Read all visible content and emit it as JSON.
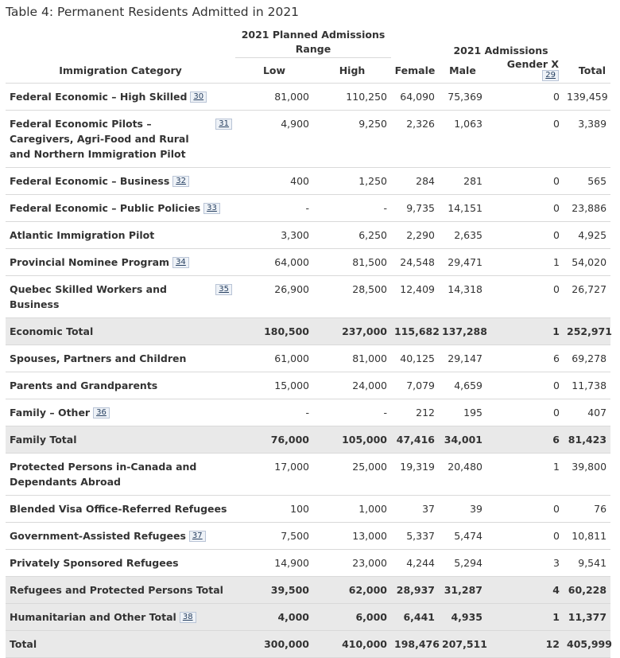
{
  "caption": "Table 4: Permanent Residents Admitted in 2021",
  "headers": {
    "planned_group": "2021 Planned Admissions Range",
    "planned_line1": "2021 Planned Admissions",
    "planned_line2": "Range",
    "admissions_group": "2021 Admissions",
    "category": "Immigration Category",
    "low": "Low",
    "high": "High",
    "female": "Female",
    "male": "Male",
    "gender_x": "Gender X",
    "gender_x_fn": "29",
    "total": "Total"
  },
  "rows": [
    {
      "category": "Federal Economic – High Skilled",
      "fn": "30",
      "low": "81,000",
      "high": "110,250",
      "female": "64,090",
      "male": "75,369",
      "gender_x": "0",
      "total": "139,459",
      "is_total": false
    },
    {
      "category": "Federal Economic Pilots – Caregivers, Agri-Food and Rural and Northern Immigration Pilot",
      "fn": "31",
      "low": "4,900",
      "high": "9,250",
      "female": "2,326",
      "male": "1,063",
      "gender_x": "0",
      "total": "3,389",
      "is_total": false
    },
    {
      "category": "Federal Economic – Business",
      "fn": "32",
      "low": "400",
      "high": "1,250",
      "female": "284",
      "male": "281",
      "gender_x": "0",
      "total": "565",
      "is_total": false
    },
    {
      "category": "Federal Economic – Public Policies",
      "fn": "33",
      "low": "-",
      "high": "-",
      "female": "9,735",
      "male": "14,151",
      "gender_x": "0",
      "total": "23,886",
      "is_total": false
    },
    {
      "category": "Atlantic Immigration Pilot",
      "fn": "",
      "low": "3,300",
      "high": "6,250",
      "female": "2,290",
      "male": "2,635",
      "gender_x": "0",
      "total": "4,925",
      "is_total": false
    },
    {
      "category": "Provincial Nominee Program",
      "fn": "34",
      "low": "64,000",
      "high": "81,500",
      "female": "24,548",
      "male": "29,471",
      "gender_x": "1",
      "total": "54,020",
      "is_total": false
    },
    {
      "category": "Quebec Skilled Workers and Business",
      "fn": "35",
      "low": "26,900",
      "high": "28,500",
      "female": "12,409",
      "male": "14,318",
      "gender_x": "0",
      "total": "26,727",
      "is_total": false
    },
    {
      "category": "Economic Total",
      "fn": "",
      "low": "180,500",
      "high": "237,000",
      "female": "115,682",
      "male": "137,288",
      "gender_x": "1",
      "total": "252,971",
      "is_total": true
    },
    {
      "category": "Spouses, Partners and Children",
      "fn": "",
      "low": "61,000",
      "high": "81,000",
      "female": "40,125",
      "male": "29,147",
      "gender_x": "6",
      "total": "69,278",
      "is_total": false
    },
    {
      "category": "Parents and Grandparents",
      "fn": "",
      "low": "15,000",
      "high": "24,000",
      "female": "7,079",
      "male": "4,659",
      "gender_x": "0",
      "total": "11,738",
      "is_total": false
    },
    {
      "category": "Family – Other",
      "fn": "36",
      "low": "-",
      "high": "-",
      "female": "212",
      "male": "195",
      "gender_x": "0",
      "total": "407",
      "is_total": false
    },
    {
      "category": "Family Total",
      "fn": "",
      "low": "76,000",
      "high": "105,000",
      "female": "47,416",
      "male": "34,001",
      "gender_x": "6",
      "total": "81,423",
      "is_total": true
    },
    {
      "category": "Protected Persons in-Canada and Dependants Abroad",
      "fn": "",
      "low": "17,000",
      "high": "25,000",
      "female": "19,319",
      "male": "20,480",
      "gender_x": "1",
      "total": "39,800",
      "is_total": false
    },
    {
      "category": "Blended Visa Office-Referred Refugees",
      "fn": "",
      "low": "100",
      "high": "1,000",
      "female": "37",
      "male": "39",
      "gender_x": "0",
      "total": "76",
      "is_total": false
    },
    {
      "category": "Government-Assisted Refugees",
      "fn": "37",
      "low": "7,500",
      "high": "13,000",
      "female": "5,337",
      "male": "5,474",
      "gender_x": "0",
      "total": "10,811",
      "is_total": false
    },
    {
      "category": "Privately Sponsored Refugees",
      "fn": "",
      "low": "14,900",
      "high": "23,000",
      "female": "4,244",
      "male": "5,294",
      "gender_x": "3",
      "total": "9,541",
      "is_total": false
    },
    {
      "category": "Refugees and Protected Persons Total",
      "fn": "",
      "low": "39,500",
      "high": "62,000",
      "female": "28,937",
      "male": "31,287",
      "gender_x": "4",
      "total": "60,228",
      "is_total": true
    },
    {
      "category": "Humanitarian and Other Total",
      "fn": "38",
      "low": "4,000",
      "high": "6,000",
      "female": "6,441",
      "male": "4,935",
      "gender_x": "1",
      "total": "11,377",
      "is_total": true
    },
    {
      "category": "Total",
      "fn": "",
      "low": "300,000",
      "high": "410,000",
      "female": "198,476",
      "male": "207,511",
      "gender_x": "12",
      "total": "405,999",
      "is_total": true
    }
  ]
}
